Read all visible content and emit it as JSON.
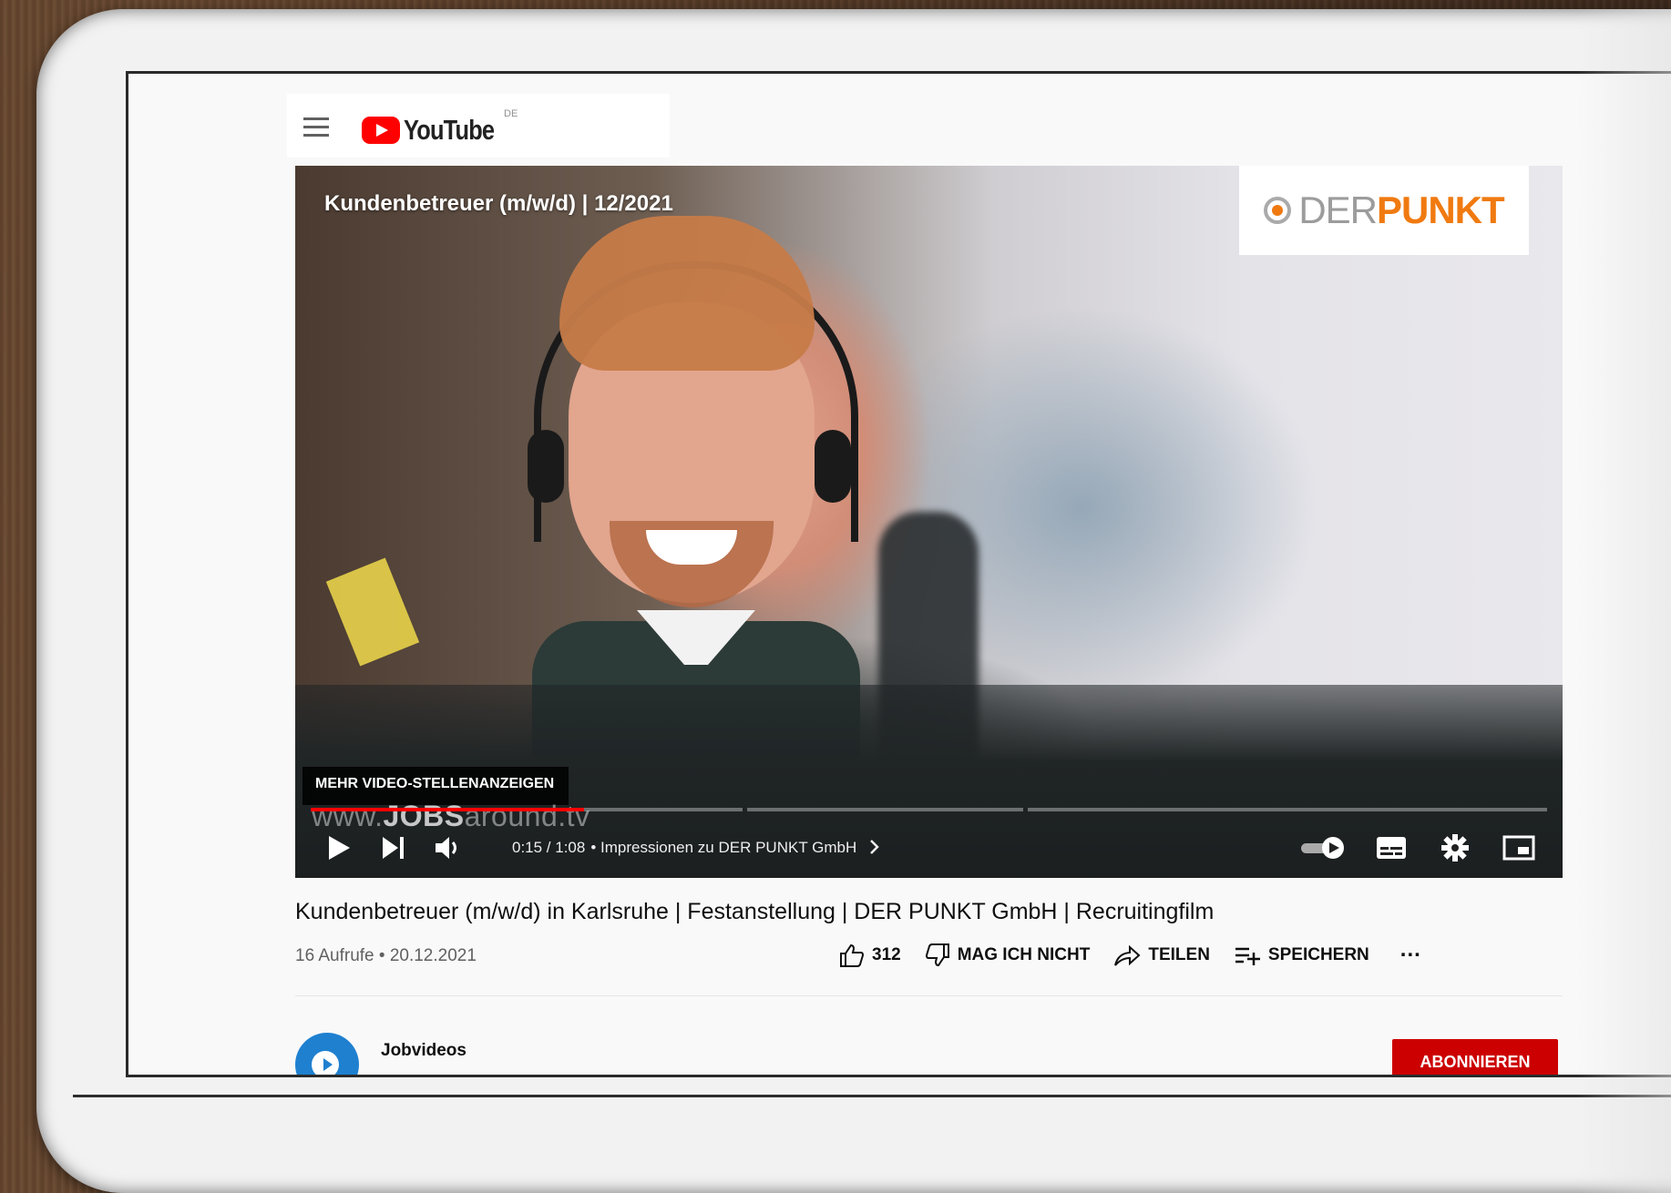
{
  "masthead": {
    "logo_text": "YouTube",
    "country_code": "DE"
  },
  "player": {
    "overlay_title": "Kundenbetreuer (m/w/d) | 12/2021",
    "brand_der": "DER",
    "brand_punkt": "PUNKT",
    "endscreen_label": "MEHR VIDEO-STELLENANZEIGEN",
    "watermark_prefix": "www.",
    "watermark_bold": "JOBS",
    "watermark_suffix": "around.tv",
    "time": "0:15 / 1:08",
    "chapter": "• Impressionen zu DER PUNKT GmbH",
    "progress_fraction": 0.221,
    "accent_color": "#ff0000"
  },
  "video": {
    "title": "Kundenbetreuer (m/w/d) in Karlsruhe | Festanstellung | DER PUNKT GmbH | Recruitingfilm",
    "meta": "16 Aufrufe • 20.12.2021"
  },
  "actions": {
    "likes": "312",
    "dislike_label": "MAG ICH NICHT",
    "share_label": "TEILEN",
    "save_label": "SPEICHERN",
    "more_label": "..."
  },
  "channel": {
    "name": "Jobvideos",
    "subscribe_label": "ABONNIEREN",
    "subscribe_color": "#cc0000"
  },
  "icons": [
    "menu-icon",
    "youtube-logo-icon",
    "play-icon",
    "next-icon",
    "volume-icon",
    "chevron-right-icon",
    "autoplay-toggle-icon",
    "subtitles-icon",
    "settings-gear-icon",
    "miniplayer-icon",
    "theater-mode-icon",
    "fullscreen-icon",
    "thumbs-up-icon",
    "thumbs-down-icon",
    "share-arrow-icon",
    "add-to-playlist-icon",
    "more-options-icon"
  ]
}
